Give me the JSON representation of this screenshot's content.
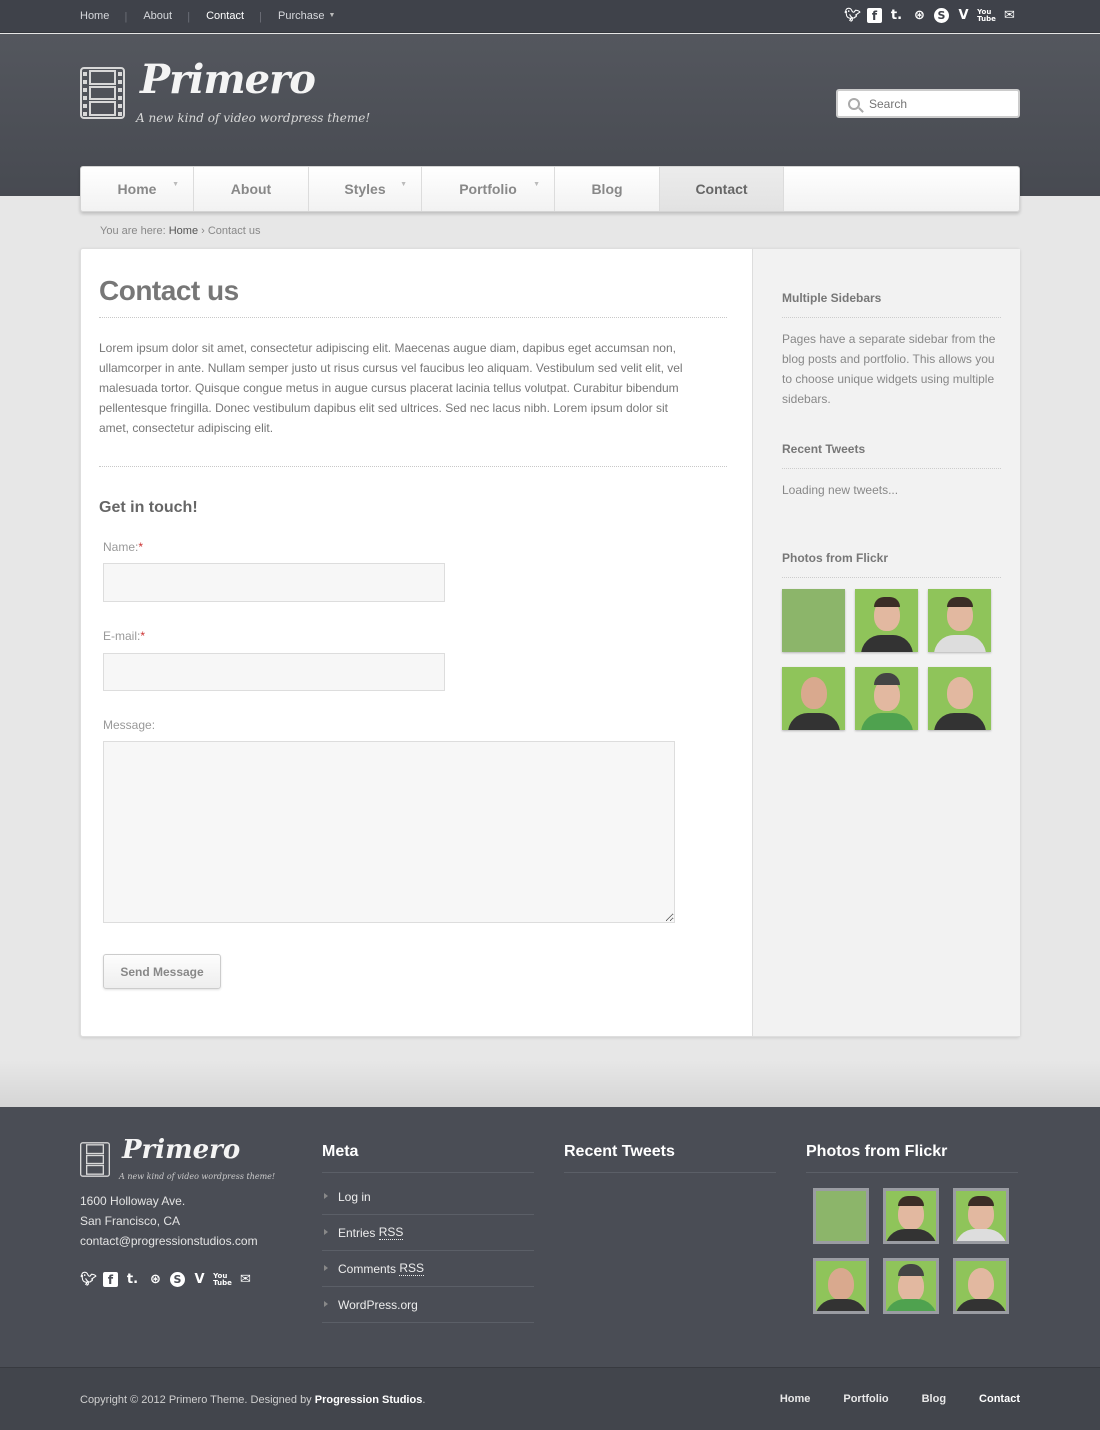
{
  "topbar": {
    "nav": [
      {
        "label": "Home",
        "active": false
      },
      {
        "label": "About",
        "active": false
      },
      {
        "label": "Contact",
        "active": true
      },
      {
        "label": "Purchase",
        "active": false,
        "dropdown": true
      }
    ],
    "social_icons": [
      "twitter-icon",
      "facebook-icon",
      "tumblr-icon",
      "dribbble-icon",
      "skype-icon",
      "vimeo-icon",
      "youtube-icon",
      "email-icon"
    ]
  },
  "header": {
    "logo_text": "Primero",
    "tagline": "A new kind of video wordpress theme!",
    "search_placeholder": "Search"
  },
  "mainnav": [
    {
      "label": "Home",
      "dropdown": true
    },
    {
      "label": "About",
      "dropdown": false
    },
    {
      "label": "Styles",
      "dropdown": true
    },
    {
      "label": "Portfolio",
      "dropdown": true
    },
    {
      "label": "Blog",
      "dropdown": false
    },
    {
      "label": "Contact",
      "dropdown": false,
      "active": true
    }
  ],
  "breadcrumb": {
    "prefix": "You are here:",
    "home": "Home",
    "sep": "›",
    "current": "Contact us"
  },
  "main": {
    "title": "Contact us",
    "intro": "Lorem ipsum dolor sit amet, consectetur adipiscing elit. Maecenas augue diam, dapibus eget accumsan non, ullamcorper in ante. Nullam semper justo ut risus cursus vel faucibus leo aliquam. Vestibulum sed velit elit, vel malesuada tortor. Quisque congue metus in augue cursus placerat lacinia tellus volutpat. Curabitur bibendum pellentesque fringilla. Donec vestibulum dapibus elit sed ultrices. Sed nec lacus nibh. Lorem ipsum dolor sit amet, consectetur adipiscing elit.",
    "form": {
      "heading": "Get in touch!",
      "name_label": "Name:",
      "email_label": "E-mail:",
      "message_label": "Message:",
      "required_mark": "*",
      "name_value": "",
      "email_value": "",
      "message_value": "",
      "submit_label": "Send Message"
    }
  },
  "sidebar": {
    "widgets": [
      {
        "title": "Multiple Sidebars",
        "text": "Pages have a separate sidebar from the blog posts and portfolio. This allows you to choose unique widgets using multiple sidebars."
      },
      {
        "title": "Recent Tweets",
        "text": "Loading new tweets..."
      },
      {
        "title": "Photos from Flickr"
      }
    ]
  },
  "footer": {
    "logo_text": "Primero",
    "tagline": "A new kind of video wordpress theme!",
    "address": [
      "1600 Holloway Ave.",
      "San Francisco, CA",
      "contact@progressionstudios.com"
    ],
    "meta_title": "Meta",
    "meta_links": [
      {
        "text": "Log in",
        "rss": ""
      },
      {
        "text": "Entries ",
        "rss": "RSS"
      },
      {
        "text": "Comments ",
        "rss": "RSS"
      },
      {
        "text": "WordPress.org",
        "rss": ""
      }
    ],
    "tweets_title": "Recent Tweets",
    "flickr_title": "Photos from Flickr"
  },
  "bottombar": {
    "copyright_prefix": "Copyright © 2012 Primero Theme. Designed by ",
    "designer": "Progression Studios",
    "copyright_suffix": ".",
    "nav": [
      {
        "label": "Home",
        "active": false
      },
      {
        "label": "Portfolio",
        "active": false
      },
      {
        "label": "Blog",
        "active": false
      },
      {
        "label": "Contact",
        "active": true
      }
    ]
  },
  "colors": {
    "header_bg": "#4c4f56",
    "footer_bg": "#4a4d55",
    "accent_required": "#cc3333",
    "photo_green": "#8fc45a"
  }
}
